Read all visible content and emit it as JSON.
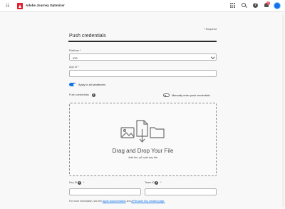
{
  "header": {
    "app_title": "Adobe Journey Optimizer",
    "notification_count": "9",
    "icons": [
      "menu-icon",
      "adobe-logo",
      "apps-grid-icon",
      "search-icon",
      "help-icon",
      "bell-icon",
      "avatar"
    ]
  },
  "form": {
    "required_note": "* Required",
    "title": "Push credentials",
    "platform": {
      "label": "Platform *",
      "value": "iOS"
    },
    "app_id": {
      "label": "App id *",
      "value": ""
    },
    "apply_all": {
      "label": "Apply to all sandboxes",
      "enabled": true
    },
    "credentials": {
      "label": "Push credentials",
      "manual_label": "Manually enter push credentials",
      "manual_enabled": false
    },
    "dropzone": {
      "title": "Drag and Drop Your File",
      "subtitle": "Add the .p8 auth key file"
    },
    "key_id": {
      "label": "Key ID",
      "required_mark": "*",
      "value": ""
    },
    "team_id": {
      "label": "Team ID",
      "required_mark": "*",
      "value": ""
    },
    "footer": {
      "prefix": "For more information, see the",
      "link1": "Apple documentation",
      "middle": "and",
      "link2": "APNs Auth Key creation page."
    }
  },
  "colors": {
    "accent": "#1473e6",
    "brand": "#e51a27",
    "badge": "#e34850"
  }
}
